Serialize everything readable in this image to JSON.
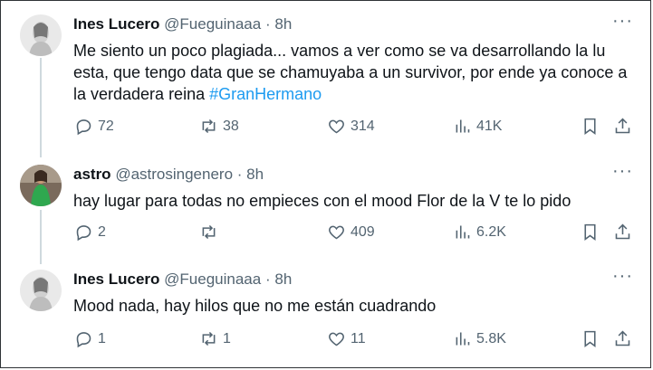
{
  "tweets": [
    {
      "name": "Ines Lucero",
      "handle": "@Fueguinaaa",
      "separator": "·",
      "time": "8h",
      "more": "···",
      "text_lines": [
        "Me siento un poco plagiada... vamos a ver como se va desarrollando la lu",
        "esta, que tengo data que se chamuyaba a un survivor, por ende ya conoce a",
        "la verdadera reina "
      ],
      "hashtag": "#GranHermano",
      "replies": "72",
      "reposts": "38",
      "likes": "314",
      "views": "41K"
    },
    {
      "name": "astro",
      "handle": "@astrosingenero",
      "separator": "·",
      "time": "8h",
      "more": "···",
      "text_lines": [
        "hay lugar para todas no empieces con el mood Flor de la V te lo pido"
      ],
      "replies": "2",
      "reposts": "",
      "likes": "409",
      "views": "6.2K"
    },
    {
      "name": "Ines Lucero",
      "handle": "@Fueguinaaa",
      "separator": "·",
      "time": "8h",
      "more": "···",
      "text_lines": [
        "Mood nada, hay hilos que no me están cuadrando"
      ],
      "replies": "1",
      "reposts": "1",
      "likes": "11",
      "views": "5.8K"
    }
  ],
  "colors": {
    "text": "#0f1419",
    "secondary": "#536471",
    "link": "#1d9bf0",
    "thread_line": "#cfd9de"
  }
}
